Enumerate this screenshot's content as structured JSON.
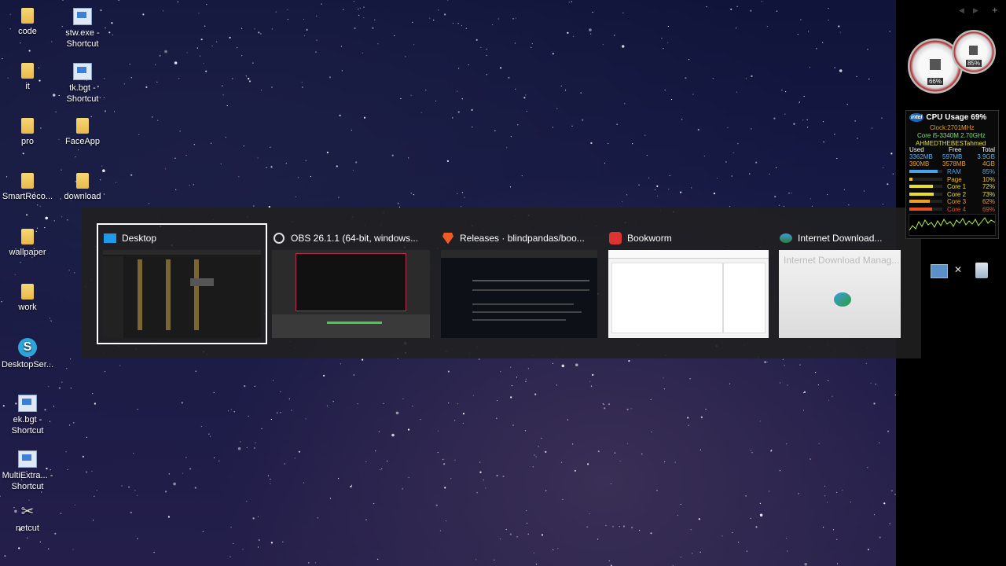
{
  "desktop_icons": [
    {
      "label": "code",
      "type": "folder"
    },
    {
      "label": "stw.exe - Shortcut",
      "type": "shortcut"
    },
    {
      "label": "it",
      "type": "folder"
    },
    {
      "label": "tk.bgt - Shortcut",
      "type": "shortcut"
    },
    {
      "label": "pro",
      "type": "folder"
    },
    {
      "label": "FaceApp",
      "type": "folder"
    },
    {
      "label": "SmartReco...",
      "type": "folder"
    },
    {
      "label": "download",
      "type": "folder"
    },
    {
      "label": "wallpaper",
      "type": "folder"
    },
    {
      "label": "work",
      "type": "folder"
    },
    {
      "label": "DesktopSer...",
      "type": "app"
    },
    {
      "label": "ek.bgt - Shortcut",
      "type": "shortcut"
    },
    {
      "label": "MultiExtra... - Shortcut",
      "type": "shortcut"
    },
    {
      "label": "netcut",
      "type": "app"
    }
  ],
  "switcher": {
    "tiles": [
      {
        "title": "Desktop",
        "icon": "desktop-icon",
        "selected": true
      },
      {
        "title": "OBS 26.1.1 (64-bit, windows...",
        "icon": "obs-icon",
        "selected": false
      },
      {
        "title": "Releases · blindpandas/boo...",
        "icon": "brave-icon",
        "selected": false
      },
      {
        "title": "Bookworm",
        "icon": "bookworm-icon",
        "selected": false
      },
      {
        "title": "Internet Download...",
        "icon": "idm-icon",
        "selected": false
      }
    ],
    "idm_thumb_text": "Internet Download Manag..."
  },
  "gauges": {
    "gauge1_value": "66%",
    "gauge2_value": "85%"
  },
  "cpu_widget": {
    "title": "CPU Usage",
    "usage": "69%",
    "clock": "Clock:2701MHz",
    "cpu_model": "Core i5-3340M 2.70GHz",
    "user": "AHMEDTHEBESTahmed",
    "headers": {
      "used": "Used",
      "free": "Free",
      "total": "Total"
    },
    "mem_rows": [
      {
        "used": "3362MB",
        "free": "597MB",
        "total": "3.9GB"
      },
      {
        "used": "390MB",
        "free": "3578MB",
        "total": "4GB"
      }
    ],
    "bars": [
      {
        "label": "RAM",
        "value": "85%",
        "fill": 0.85,
        "color": "#4aa3e8"
      },
      {
        "label": "Page",
        "value": "10%",
        "fill": 0.1,
        "color": "#f0c020"
      },
      {
        "label": "Core 1",
        "value": "72%",
        "fill": 0.72,
        "color": "#e8e020"
      },
      {
        "label": "Core 2",
        "value": "73%",
        "fill": 0.73,
        "color": "#e8e020"
      },
      {
        "label": "Core 3",
        "value": "62%",
        "fill": 0.62,
        "color": "#f0a020"
      },
      {
        "label": "Core 4",
        "value": "69%",
        "fill": 0.69,
        "color": "#e85020"
      }
    ]
  },
  "accent_colors": {
    "label_orange": "#e8a020",
    "label_green": "#7fe07f",
    "label_blue": "#5bb0f0"
  }
}
